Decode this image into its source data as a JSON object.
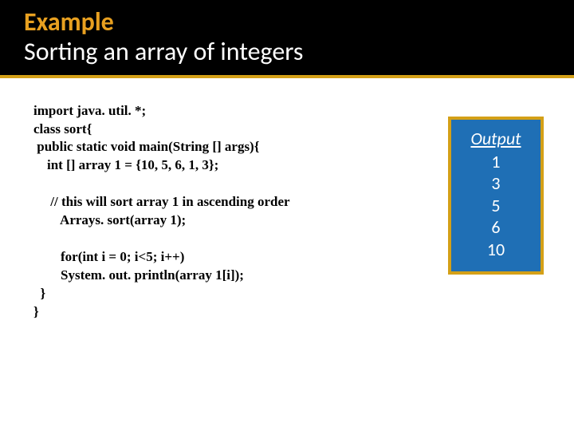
{
  "title": {
    "line1": "Example",
    "line2": "Sorting an array of integers"
  },
  "code": {
    "l1": "import java. util. *;",
    "l2": "class sort{",
    "l3": " public static void main(String [] args){",
    "l4": "    int [] array 1 = {10, 5, 6, 1, 3};",
    "l5": "",
    "l6": "     // this will sort array 1 in ascending order",
    "l7": "        Arrays. sort(array 1);",
    "l8": "",
    "l9": "        for(int i = 0; i<5; i++)",
    "l10": "        System. out. println(array 1[i]);",
    "l11": "  }",
    "l12": "}"
  },
  "output": {
    "heading": "Output",
    "values": [
      "1",
      "3",
      "5",
      "6",
      "10"
    ]
  }
}
